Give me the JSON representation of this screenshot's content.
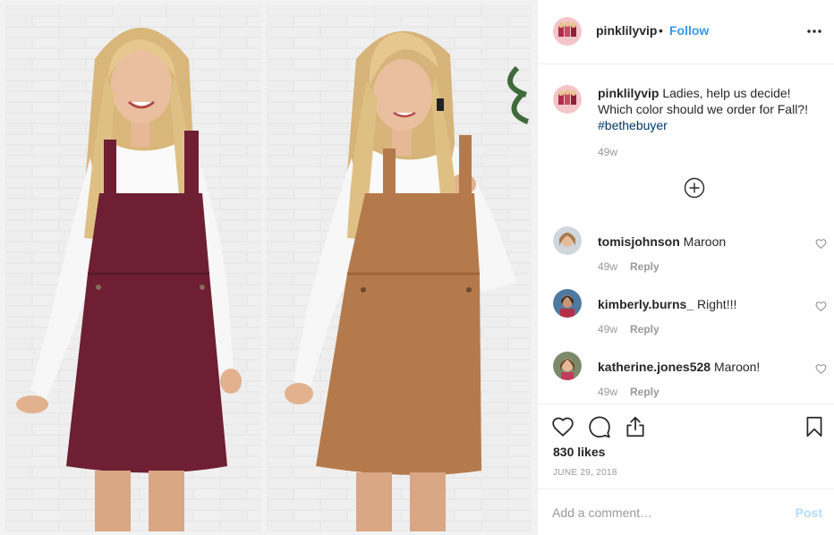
{
  "post": {
    "username": "pinklilyvip",
    "separator": "•",
    "follow_label": "Follow"
  },
  "caption": {
    "username": "pinklilyvip",
    "text": " Ladies, help us decide! Which color should we order for Fall?! ",
    "hashtag": "#bethebuyer",
    "time": "49w"
  },
  "comments": [
    {
      "username": "tomisjohnson",
      "text": " Maroon",
      "time": "49w",
      "reply_label": "Reply"
    },
    {
      "username": "kimberly.burns_",
      "text": " Right!!!",
      "time": "49w",
      "reply_label": "Reply"
    },
    {
      "username": "katherine.jones528",
      "text": " Maroon!",
      "time": "49w",
      "reply_label": "Reply"
    }
  ],
  "likes_text": "830 likes",
  "date": "JUNE 29, 2018",
  "add_comment": {
    "placeholder": "Add a comment…",
    "post_label": "Post"
  },
  "icons": {
    "more": "more-options-icon",
    "load_more": "plus-circle-icon",
    "like": "heart-icon",
    "comment": "comment-bubble-icon",
    "share": "share-icon",
    "save": "bookmark-icon"
  },
  "colors": {
    "accent": "#3897f0",
    "post_disabled": "#b3dbff",
    "muted": "#999999",
    "maroon_dress": "#6e1f33",
    "camel_dress": "#b57a4c"
  }
}
